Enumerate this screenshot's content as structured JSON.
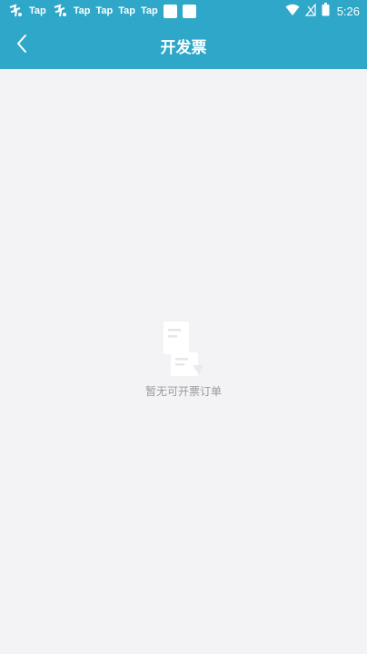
{
  "status_bar": {
    "notifications": [
      {
        "type": "logo",
        "icon": "app-logo-icon"
      },
      {
        "type": "text",
        "label": "Tap"
      },
      {
        "type": "logo",
        "icon": "app-logo-icon"
      },
      {
        "type": "text",
        "label": "Tap"
      },
      {
        "type": "text",
        "label": "Tap"
      },
      {
        "type": "text",
        "label": "Tap"
      },
      {
        "type": "text",
        "label": "Tap"
      },
      {
        "type": "square",
        "icon": "notification-square-icon"
      },
      {
        "type": "square",
        "icon": "notification-square-icon"
      }
    ],
    "icons": [
      "wifi-icon",
      "signal-icon",
      "battery-icon"
    ],
    "time": "5:26"
  },
  "app_bar": {
    "title": "开发票",
    "back_icon": "chevron-left-icon",
    "color": "#2ea7c9"
  },
  "empty_state": {
    "icon": "empty-document-icon",
    "message": "暂无可开票订单"
  }
}
